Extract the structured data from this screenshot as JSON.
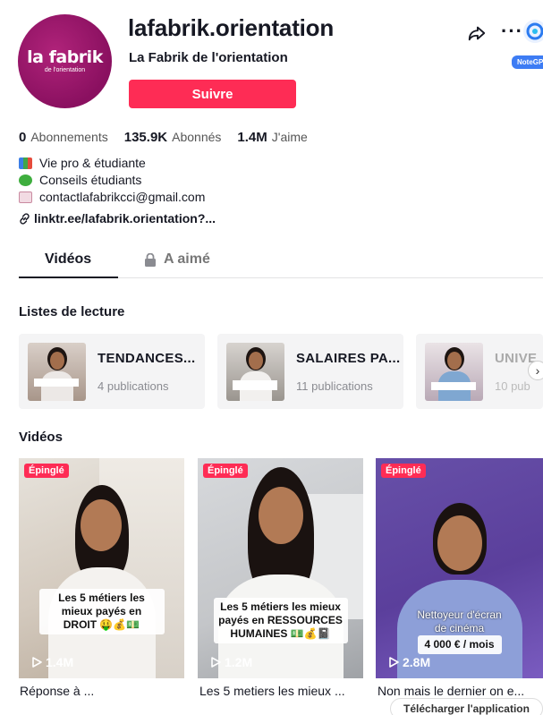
{
  "profile": {
    "avatar_line1": "la fabrik",
    "avatar_line2": "de l'orientation",
    "username": "lafabrik.orientation",
    "nickname": "La Fabrik de l'orientation",
    "follow_label": "Suivre"
  },
  "header_actions": {
    "notegpt_label": "NoteGP"
  },
  "stats": {
    "following_count": "0",
    "following_label": "Abonnements",
    "followers_count": "135.9K",
    "followers_label": "Abonnés",
    "likes_count": "1.4M",
    "likes_label": "J'aime"
  },
  "bio": {
    "line1": "Vie pro & étudiante",
    "line2": "Conseils étudiants",
    "line3": "contactlafabrikcci@gmail.com",
    "link": "linktr.ee/lafabrik.orientation?..."
  },
  "tabs": {
    "videos": "Vidéos",
    "liked": "A aimé"
  },
  "playlists_section": {
    "title": "Listes de lecture",
    "items": [
      {
        "title": "TENDANCES...",
        "count": "4 publications"
      },
      {
        "title": "SALAIRES PA...",
        "count": "11 publications"
      },
      {
        "title": "UNIVE",
        "count": "10 pub"
      }
    ]
  },
  "videos_section": {
    "title": "Vidéos",
    "items": [
      {
        "pinned": "Épinglé",
        "overlay": "Les 5 métiers les mieux payés en DROIT 🤑💰💵",
        "views": "1.4M",
        "caption": "Réponse à ..."
      },
      {
        "pinned": "Épinglé",
        "overlay": "Les 5 métiers les mieux payés en RESSOURCES HUMAINES 💵💰📓",
        "views": "1.2M",
        "caption": "Les 5 metiers les mieux ..."
      },
      {
        "pinned": "Épinglé",
        "overlay_top": "Nettoyeur d'écran de cinéma",
        "overlay": "4 000 € / mois",
        "views": "2.8M",
        "caption": "Non mais le dernier on e..."
      }
    ]
  },
  "download_button": "Télécharger l'application",
  "colors": {
    "accent": "#fe2c55",
    "brand_magenta": "#9e1b6e"
  }
}
